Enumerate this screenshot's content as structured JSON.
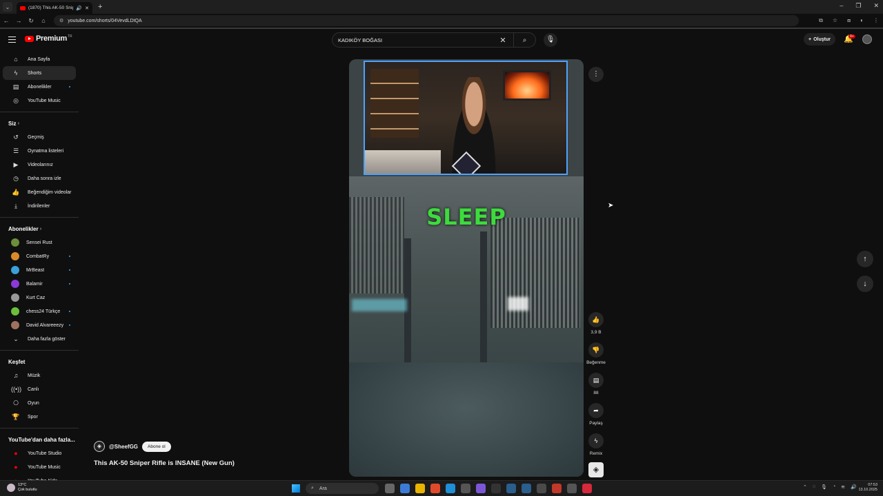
{
  "browser": {
    "tab_title": "(1870) This AK-50 Sniper Ri",
    "url": "youtube.com/shorts/04VevdLDtQA"
  },
  "header": {
    "brand": "Premium",
    "brand_mark": "TR",
    "search_value": "KADIKÖY BOĞASI",
    "create_label": "Oluştur",
    "notif_count": "9+"
  },
  "sidebar": {
    "main": [
      {
        "label": "Ana Sayfa",
        "icon": "home-icon"
      },
      {
        "label": "Shorts",
        "icon": "shorts-icon",
        "active": true
      },
      {
        "label": "Abonelikler",
        "icon": "subscriptions-icon",
        "dot": true
      },
      {
        "label": "YouTube Music",
        "icon": "music-circle-icon"
      }
    ],
    "you_heading": "Siz",
    "you": [
      {
        "label": "Geçmiş",
        "icon": "history-icon"
      },
      {
        "label": "Oynatma listeleri",
        "icon": "playlists-icon"
      },
      {
        "label": "Videolarınız",
        "icon": "your-videos-icon"
      },
      {
        "label": "Daha sonra izle",
        "icon": "watch-later-icon"
      },
      {
        "label": "Beğendiğim videolar",
        "icon": "liked-icon"
      },
      {
        "label": "İndirilenler",
        "icon": "download-icon"
      }
    ],
    "subs_heading": "Abonelikler",
    "subs": [
      {
        "label": "Sensei Rust",
        "color": "#6b8f3a"
      },
      {
        "label": "CombatRy",
        "color": "#d98b2b",
        "dot": true
      },
      {
        "label": "MrBeast",
        "color": "#3aa0d9",
        "dot": true
      },
      {
        "label": "Balamir",
        "color": "#8a3ad9",
        "dot": true
      },
      {
        "label": "Kurt Caz",
        "color": "#999999"
      },
      {
        "label": "chess24 Türkçe",
        "color": "#6bbf3a",
        "dot": true
      },
      {
        "label": "David Alvareeezy",
        "color": "#a07060",
        "dot": true
      }
    ],
    "show_more": "Daha fazla göster",
    "explore_heading": "Keşfet",
    "explore": [
      {
        "label": "Müzik",
        "icon": "music-note-icon"
      },
      {
        "label": "Canlı",
        "icon": "live-icon"
      },
      {
        "label": "Oyun",
        "icon": "gaming-icon"
      },
      {
        "label": "Spor",
        "icon": "trophy-icon"
      }
    ],
    "more_heading": "YouTube'dan daha fazla...",
    "more": [
      {
        "label": "YouTube Studio"
      },
      {
        "label": "YouTube Music"
      },
      {
        "label": "YouTube Kids"
      }
    ]
  },
  "video": {
    "overlay_text": "SLEEP",
    "channel": "@SheefGG",
    "subscribe_label": "Abone ol",
    "title": "This AK-50 Sniper Rifle is INSANE (New Gun)"
  },
  "actions": {
    "likes": "3,9 B",
    "dislike_label": "Beğenme",
    "comments": "88",
    "share_label": "Paylaş",
    "remix_label": "Remix"
  },
  "taskbar": {
    "temp": "13°C",
    "weather": "Çok bulutlu",
    "search_placeholder": "Ara",
    "time": "07:53",
    "date": "13.10.2025"
  }
}
